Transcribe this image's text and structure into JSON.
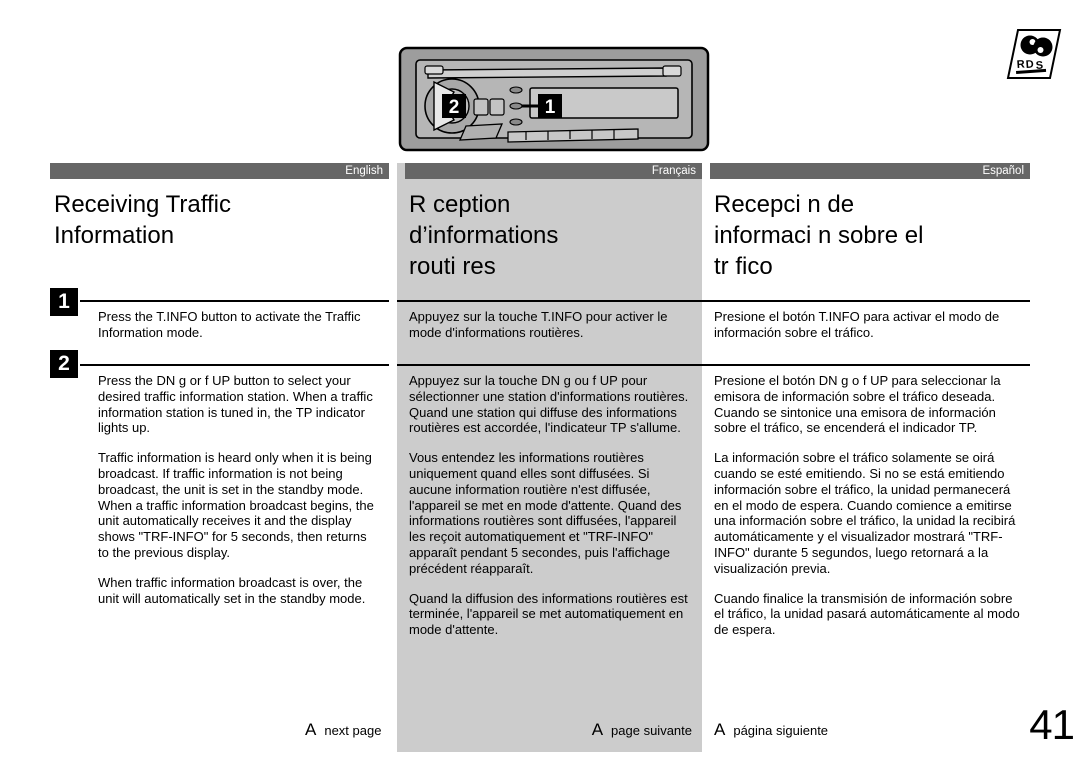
{
  "logo": {
    "name": "rds-logo",
    "text": "RDS"
  },
  "illustration": {
    "name": "car-stereo-head-unit",
    "callout_1": "1",
    "callout_2": "2"
  },
  "columns": [
    {
      "lang_label": "English",
      "heading": "Receiving Traffic\nInformation",
      "step1": "Press the T.INFO button to activate the Traffic Information mode.",
      "step2_paragraphs": [
        "Press the  DN g    or f    UP button to select your desired traffic information station. When a traffic information station is tuned in, the TP indicator lights up.",
        "Traffic information is heard only when it is being broadcast. If traffic information is not being broadcast, the unit is set in the standby mode. When a traffic information broadcast begins, the unit automatically receives it and the display shows \"TRF-INFO\" for 5 seconds, then returns to the previous display.",
        "When traffic information broadcast is over, the unit will automatically set in the standby mode."
      ],
      "footer_arrow": "A",
      "footer_text": "next page"
    },
    {
      "lang_label": "Français",
      "heading": "R ception\nd’informations\nrouti res",
      "step1": "Appuyez sur la touche T.INFO pour activer le mode d'informations routières.",
      "step2_paragraphs": [
        "Appuyez sur la touche DN g    ou f     UP pour sélectionner une station d'informations routières. Quand une station qui diffuse des informations routières est accordée, l'indicateur TP s'allume.",
        "Vous entendez les informations routières uniquement quand elles sont diffusées. Si aucune information routière n'est diffusée, l'appareil se met en mode d'attente. Quand des informations routières sont diffusées, l'appareil les reçoit automatiquement et \"TRF-INFO\" apparaît pendant 5 secondes, puis l'affichage précédent réapparaît.",
        "Quand la diffusion des informations routières est terminée, l'appareil se met automatiquement en mode d'attente."
      ],
      "footer_arrow": "A",
      "footer_text": "page suivante"
    },
    {
      "lang_label": "Español",
      "heading": "Recepci n de\ninformaci n sobre el\ntr fico",
      "step1": "Presione el botón T.INFO para activar el modo de información sobre el tráfico.",
      "step2_paragraphs": [
        "Presione el botón DN g    o f     UP para seleccionar la emisora de información sobre el tráfico deseada. Cuando se sintonice una emisora de información sobre el tráfico, se encenderá el indicador TP.",
        "La información sobre el tráfico solamente se oirá cuando se esté emitiendo. Si no se está emitiendo información sobre el tráfico, la unidad permanecerá en el modo de espera. Cuando comience a emitirse una información sobre el tráfico, la unidad la recibirá automáticamente y el visualizador mostrará \"TRF-INFO\" durante 5 segundos, luego retornará a la visualización previa.",
        "Cuando finalice la transmisión de información sobre el tráfico, la unidad pasará automáticamente al modo de espera."
      ],
      "footer_arrow": "A",
      "footer_text": "página siguiente"
    }
  ],
  "steps": {
    "badge_1": "1",
    "badge_2": "2"
  },
  "page_number": "41",
  "colors": {
    "lang_bar": "#666666",
    "column_shade": "#cccccc",
    "text": "#000000"
  }
}
